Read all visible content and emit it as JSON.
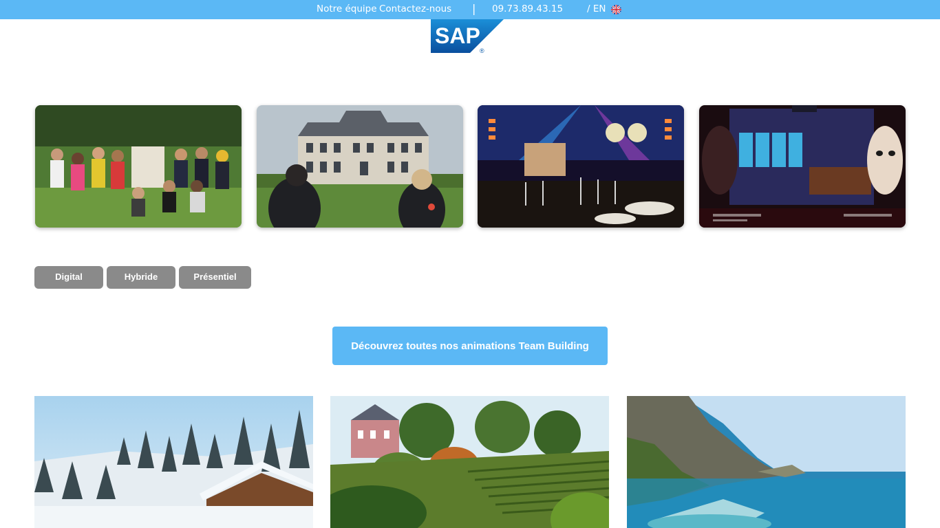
{
  "topbar": {
    "team_link": "Notre équipe",
    "contact_link": "Contactez-nous",
    "separator": "|",
    "phone": "09.73.89.43.15",
    "language": "/ EN",
    "flag_icon": "uk-flag-icon"
  },
  "logo": {
    "text": "SAP",
    "registered": "®",
    "brand_color": "#0a5aa8"
  },
  "cards": [
    {
      "name": "team-group-photo"
    },
    {
      "name": "chateau-photo"
    },
    {
      "name": "gala-dinner-photo"
    },
    {
      "name": "virtual-casino-photo"
    }
  ],
  "filters": [
    {
      "label": "Digital"
    },
    {
      "label": "Hybride"
    },
    {
      "label": "Présentiel"
    }
  ],
  "cta": {
    "label": "Découvrez toutes nos animations Team Building"
  },
  "photos": [
    {
      "name": "snowy-chalet-photo"
    },
    {
      "name": "vineyard-chateau-photo"
    },
    {
      "name": "coastal-cliff-photo"
    }
  ],
  "colors": {
    "accent": "#5bb8f5",
    "filter_bg": "#8a8a8a"
  }
}
